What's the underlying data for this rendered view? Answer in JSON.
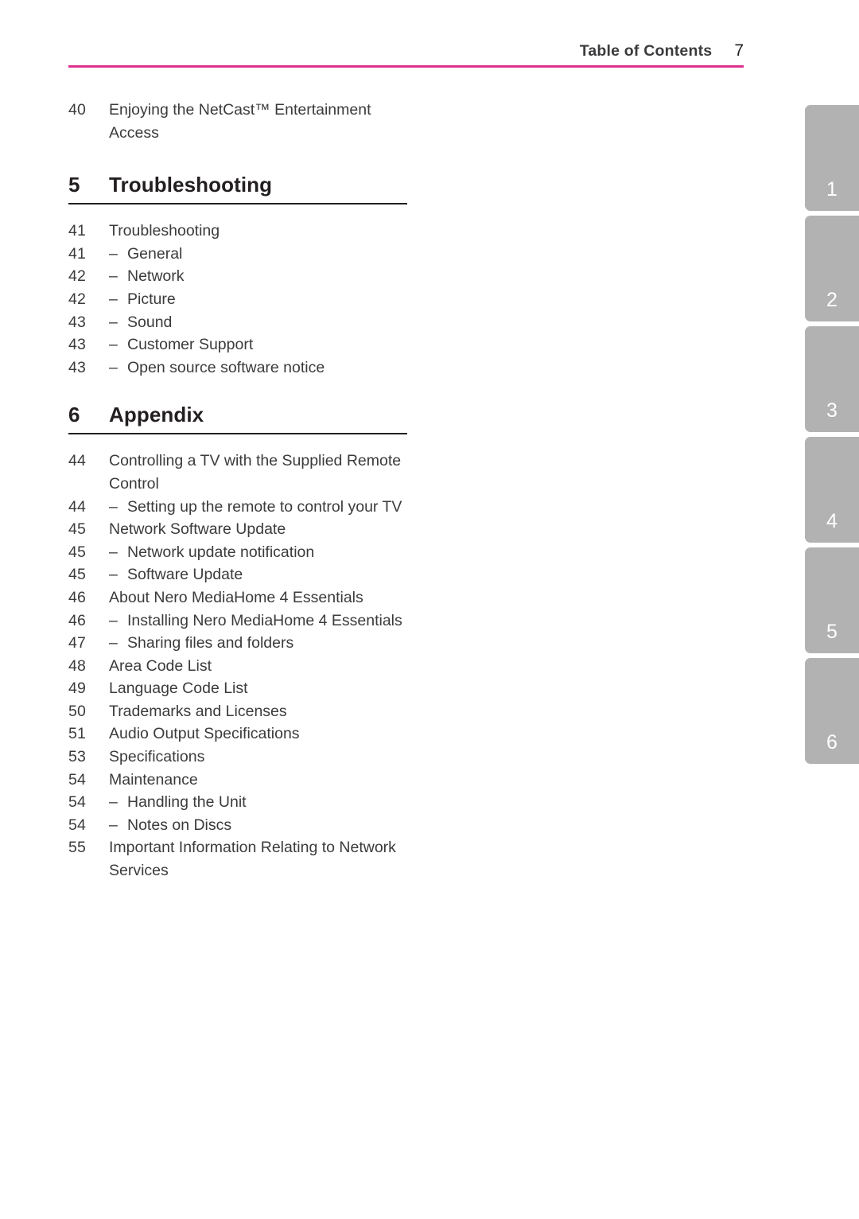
{
  "header": {
    "title": "Table of Contents",
    "page_number": "7",
    "rule_color": "#e0318d"
  },
  "colors": {
    "accent_pink": "#e0318d",
    "text": "#3b3b3d",
    "heading": "#231f20",
    "tab_gray": "#b2b2b2",
    "tab_number": "#ffffff"
  },
  "toc": {
    "leading_entries": [
      {
        "page": "40",
        "label": "Enjoying the NetCast™ Entertainment Access",
        "sub": false
      }
    ],
    "chapters": [
      {
        "number": "5",
        "title": "Troubleshooting",
        "entries": [
          {
            "page": "41",
            "label": "Troubleshooting",
            "sub": false
          },
          {
            "page": "41",
            "label": "General",
            "sub": true
          },
          {
            "page": "42",
            "label": "Network",
            "sub": true
          },
          {
            "page": "42",
            "label": "Picture",
            "sub": true
          },
          {
            "page": "43",
            "label": "Sound",
            "sub": true
          },
          {
            "page": "43",
            "label": "Customer Support",
            "sub": true
          },
          {
            "page": "43",
            "label": "Open source software notice",
            "sub": true
          }
        ]
      },
      {
        "number": "6",
        "title": "Appendix",
        "entries": [
          {
            "page": "44",
            "label": "Controlling a TV with the Supplied Remote Control",
            "sub": false
          },
          {
            "page": "44",
            "label": "Setting up the remote to control your TV",
            "sub": true
          },
          {
            "page": "45",
            "label": "Network Software Update",
            "sub": false
          },
          {
            "page": "45",
            "label": "Network update notification",
            "sub": true
          },
          {
            "page": "45",
            "label": "Software Update",
            "sub": true
          },
          {
            "page": "46",
            "label": "About Nero MediaHome 4 Essentials",
            "sub": false
          },
          {
            "page": "46",
            "label": "Installing Nero MediaHome 4 Essentials",
            "sub": true
          },
          {
            "page": "47",
            "label": "Sharing files and folders",
            "sub": true
          },
          {
            "page": "48",
            "label": "Area Code List",
            "sub": false
          },
          {
            "page": "49",
            "label": "Language Code List",
            "sub": false
          },
          {
            "page": "50",
            "label": "Trademarks and Licenses",
            "sub": false
          },
          {
            "page": "51",
            "label": "Audio Output Specifications",
            "sub": false
          },
          {
            "page": "53",
            "label": "Specifications",
            "sub": false
          },
          {
            "page": "54",
            "label": "Maintenance",
            "sub": false
          },
          {
            "page": "54",
            "label": "Handling the Unit",
            "sub": true
          },
          {
            "page": "54",
            "label": "Notes on Discs",
            "sub": true
          },
          {
            "page": "55",
            "label": "Important Information Relating to Network Services",
            "sub": false
          }
        ]
      }
    ],
    "sub_dash": "–"
  },
  "side_tabs": [
    {
      "label": "1"
    },
    {
      "label": "2"
    },
    {
      "label": "3"
    },
    {
      "label": "4"
    },
    {
      "label": "5"
    },
    {
      "label": "6"
    }
  ]
}
